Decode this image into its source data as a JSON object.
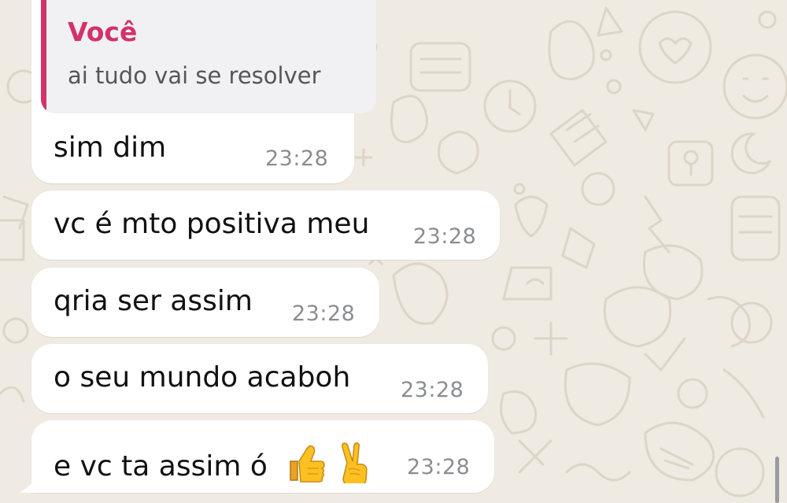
{
  "chat": {
    "reply": {
      "author": "Você",
      "quoted_text": "ai tudo vai se resolver",
      "author_color": "#d23369"
    },
    "messages": [
      {
        "text": "sim dim",
        "time": "23:28"
      },
      {
        "text": "vc é mto positiva meu",
        "time": "23:28"
      },
      {
        "text": "qria ser assim",
        "time": "23:28"
      },
      {
        "text": "o seu mundo acaboh",
        "time": "23:28"
      },
      {
        "text": "e vc ta assim ó",
        "time": "23:28",
        "emojis": [
          "thumbs-up",
          "victory-hand"
        ]
      }
    ],
    "colors": {
      "wallpaper": "#efeae2",
      "bubble": "#ffffff",
      "timestamp": "#8a8d91",
      "doodle": "#ddd5c7"
    },
    "icons": [
      "thumbs-up-emoji",
      "victory-hand-emoji"
    ]
  }
}
